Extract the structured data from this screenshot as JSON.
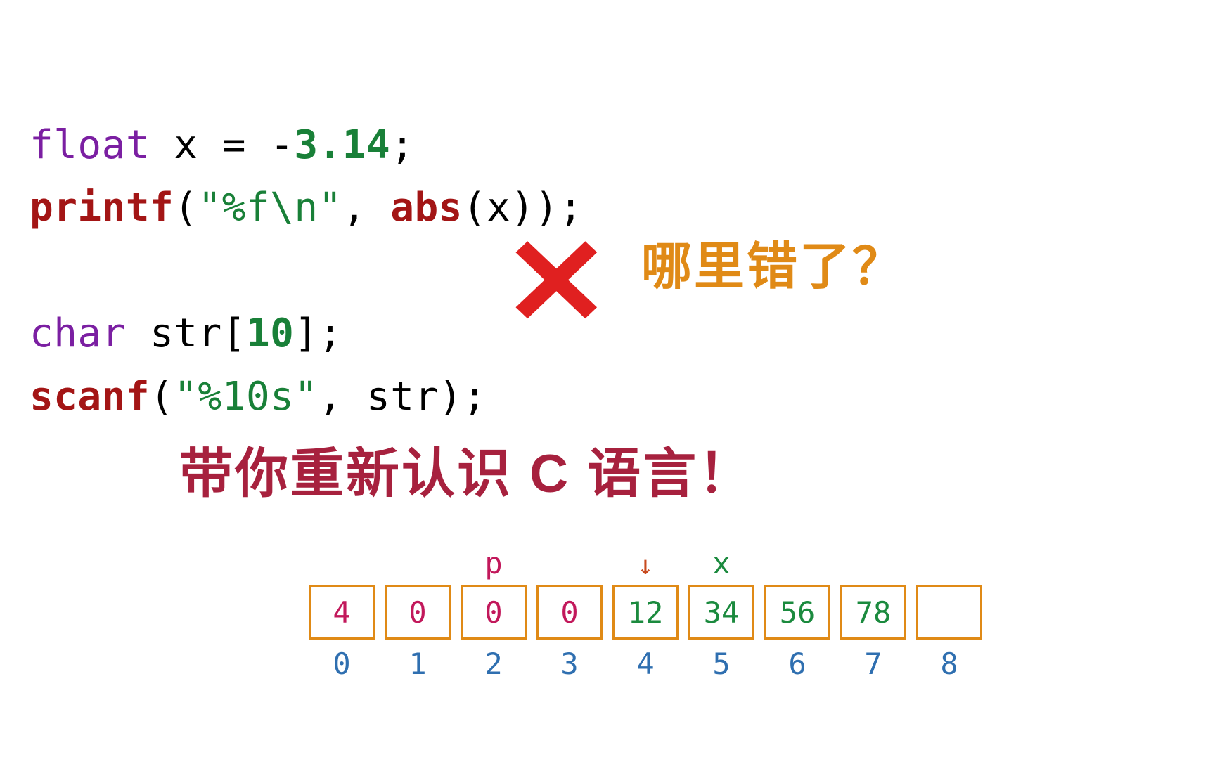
{
  "code": {
    "line1": {
      "type_kw": "float",
      "ident": " x = -",
      "num": "3.14",
      "end": ";"
    },
    "line2": {
      "fn": "printf",
      "open": "(",
      "str": "\"%f\\n\"",
      "comma": ", ",
      "fn2": "abs",
      "rest": "(x));"
    },
    "line3": {
      "type_kw": "char",
      "ident": " str[",
      "num": "10",
      "end": "];"
    },
    "line4": {
      "fn": "scanf",
      "open": "(",
      "str": "\"%10s\"",
      "comma": ", str);"
    }
  },
  "bigx": "✕",
  "question": "哪里错了？",
  "subtitle": "带你重新认识 C 语言！",
  "mem": {
    "top_labels": [
      "",
      "",
      "p",
      "",
      "↓",
      "x",
      "",
      "",
      ""
    ],
    "top_classes": [
      "",
      "",
      "lbl-p",
      "",
      "lbl-arrow",
      "lbl-x",
      "",
      "",
      ""
    ],
    "values": [
      "4",
      "0",
      "0",
      "0",
      "12",
      "34",
      "56",
      "78",
      ""
    ],
    "value_classes": [
      "val-p",
      "val-p",
      "val-p",
      "val-p",
      "val-x",
      "val-x",
      "val-x",
      "val-x",
      ""
    ],
    "indices": [
      "0",
      "1",
      "2",
      "3",
      "4",
      "5",
      "6",
      "7",
      "8"
    ]
  }
}
